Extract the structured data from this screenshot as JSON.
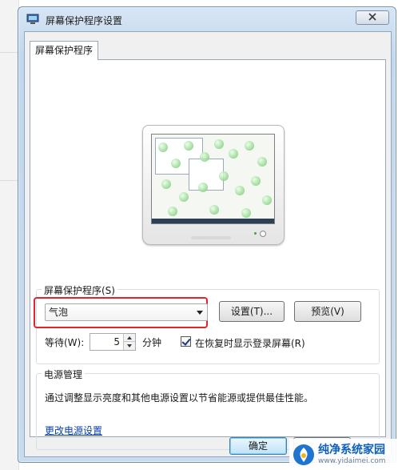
{
  "window": {
    "title": "屏幕保护程序设置",
    "close_icon": "close-icon"
  },
  "tabs": [
    {
      "label": "屏幕保护程序"
    }
  ],
  "screensaver": {
    "group_title": "屏幕保护程序(S)",
    "selected": "气泡",
    "settings_button": "设置(T)...",
    "preview_button": "预览(V)",
    "wait_label": "等待(W):",
    "wait_value": "5",
    "wait_unit": "分钟",
    "resume_checkbox_label": "在恢复时显示登录屏幕(R)",
    "resume_checked": true
  },
  "power": {
    "group_title": "电源管理",
    "description": "通过调整显示亮度和其他电源设置以节省能源或提供最佳性能。",
    "link": "更改电源设置"
  },
  "footer": {
    "ok_button": "确定"
  },
  "watermark": {
    "title": "纯净系统家园",
    "url": "www.yidaimei.com"
  },
  "colors": {
    "highlight": "#e0262a",
    "link": "#0b3fa8",
    "bubble": "#8fd48a"
  }
}
